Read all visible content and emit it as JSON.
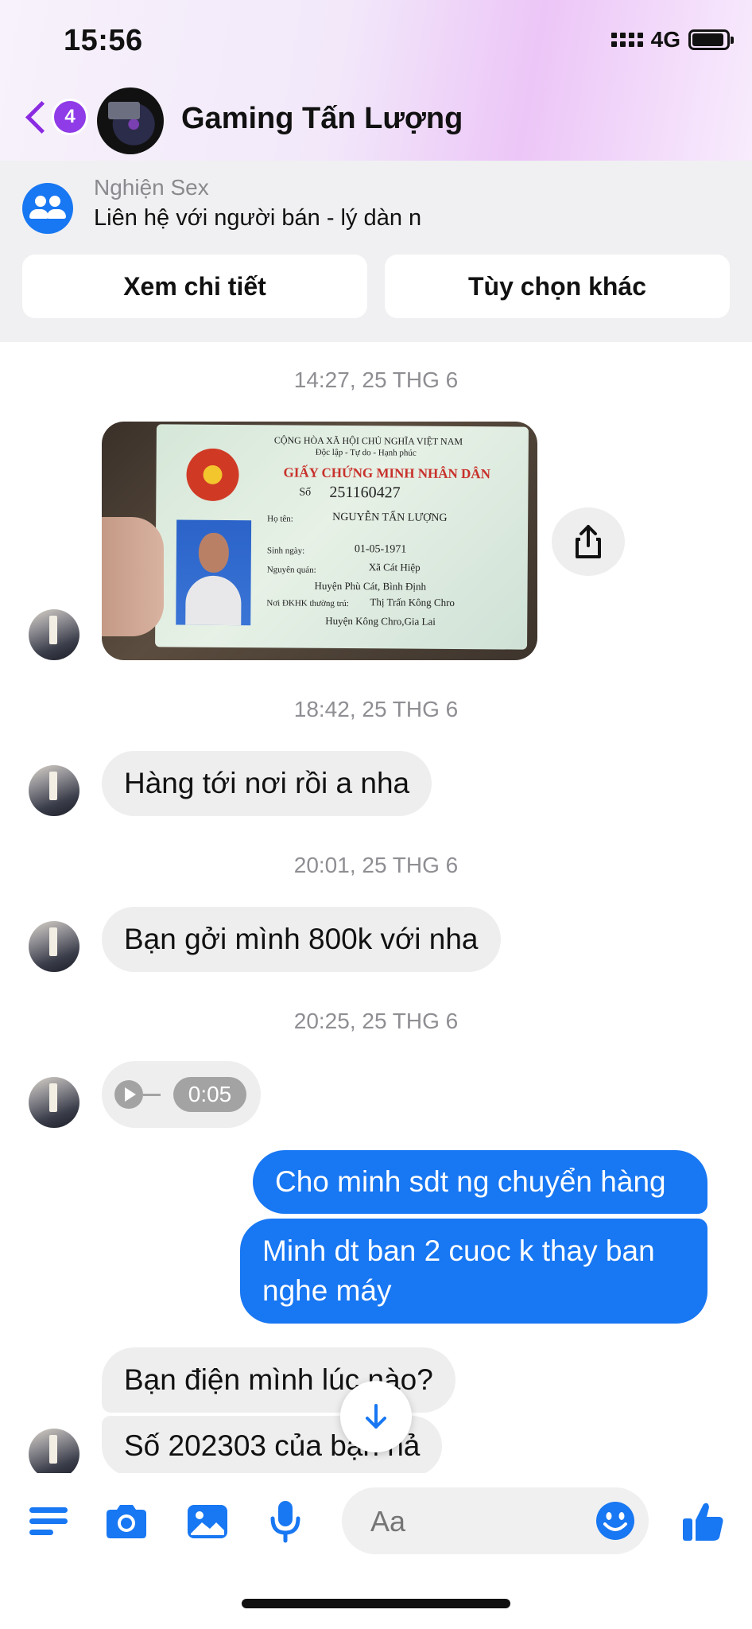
{
  "status": {
    "time": "15:56",
    "network": "4G"
  },
  "header": {
    "back_badge": "4",
    "title": "Gaming Tấn Lượng"
  },
  "context": {
    "group_name": "Nghiện Sex",
    "subtitle": "Liên hệ với người bán - lý dàn n",
    "btn_details": "Xem chi tiết",
    "btn_options": "Tùy chọn khác"
  },
  "id_card": {
    "line1": "CỘNG HÒA XÃ HỘI CHỦ NGHĨA VIỆT NAM",
    "line2": "Độc lập - Tự do - Hạnh phúc",
    "title": "GIẤY CHỨNG MINH NHÂN DÂN",
    "so_label": "Số",
    "number": "251160427",
    "name_label": "Họ tên:",
    "name": "NGUYỄN TẤN LƯỢNG",
    "dob_label": "Sinh ngày:",
    "dob": "01-05-1971",
    "origin_label": "Nguyên quán:",
    "origin1": "Xã Cát Hiệp",
    "origin2": "Huyện Phù Cát, Bình Định",
    "residence_label": "Nơi ĐKHK thường trú:",
    "residence1": "Thị Trấn Kông Chro",
    "residence2": "Huyện Kông Chro,Gia Lai"
  },
  "messages": {
    "ts1": "14:27, 25 THG 6",
    "ts2": "18:42, 25 THG 6",
    "msg1": "Hàng tới nơi rồi a nha",
    "ts3": "20:01, 25 THG 6",
    "msg2": "Bạn gởi mình 800k với nha",
    "ts4": "20:25, 25 THG 6",
    "voice_duration": "0:05",
    "out1": "Cho minh sdt ng chuyển hàng",
    "out2": "Minh dt ban 2 cuoc k thay ban nghe máy",
    "msg3": "Bạn điện mình lúc nào?",
    "msg4": "Số 202303 của bạn hả"
  },
  "composer": {
    "placeholder": "Aa"
  },
  "colors": {
    "accent": "#1877f2",
    "badge": "#8f3be8",
    "incoming_bubble": "#eeeeee"
  }
}
